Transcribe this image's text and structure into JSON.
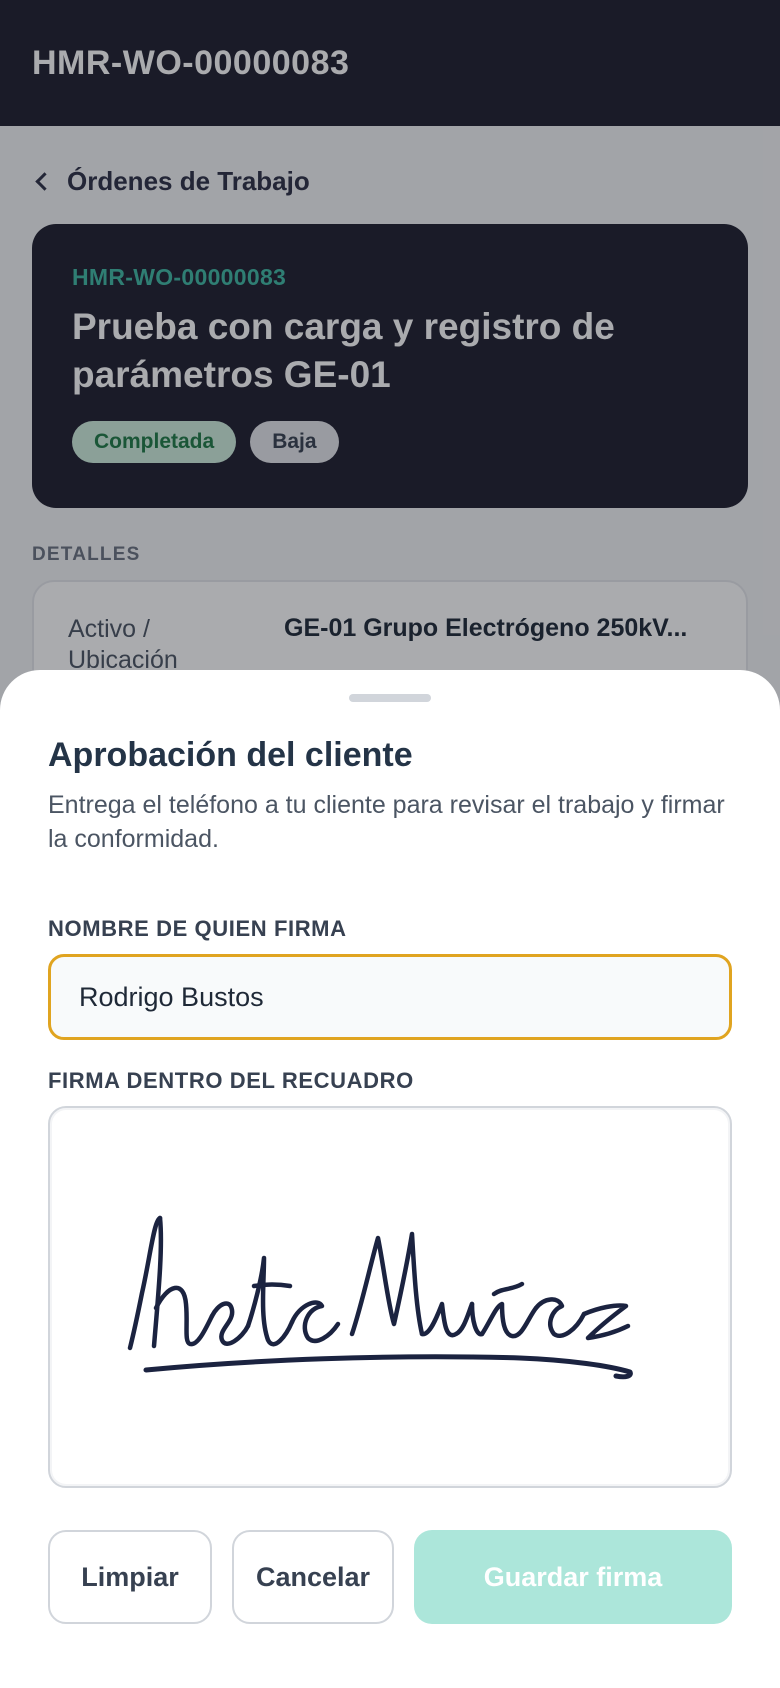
{
  "app_bar": {
    "title": "HMR-WO-00000083"
  },
  "breadcrumb": {
    "label": "Órdenes de Trabajo",
    "icon": "chevron-left-icon"
  },
  "work_order": {
    "code": "HMR-WO-00000083",
    "title": "Prueba con carga y registro de parámetros GE-01",
    "status": "Completada",
    "priority": "Baja"
  },
  "details": {
    "section_label": "DETALLES",
    "rows": [
      {
        "key": "Activo / Ubicación",
        "value": "GE-01 Grupo Electrógeno 250kV..."
      }
    ]
  },
  "sheet": {
    "title": "Aprobación del cliente",
    "description": "Entrega el teléfono a tu cliente para revisar el trabajo y firmar la conformidad.",
    "name_label": "NOMBRE DE QUIEN FIRMA",
    "name_value": "Rodrigo Bustos",
    "signature_label": "FIRMA DENTRO DEL RECUADRO",
    "buttons": {
      "clear": "Limpiar",
      "cancel": "Cancelar",
      "save": "Guardar firma"
    }
  },
  "colors": {
    "app_bar": "#1e1e2e",
    "accent_teal": "#3fb9a3",
    "input_focus_border": "#e0a420",
    "save_button_disabled": "#ace6da",
    "signature_ink": "#1b2340"
  }
}
